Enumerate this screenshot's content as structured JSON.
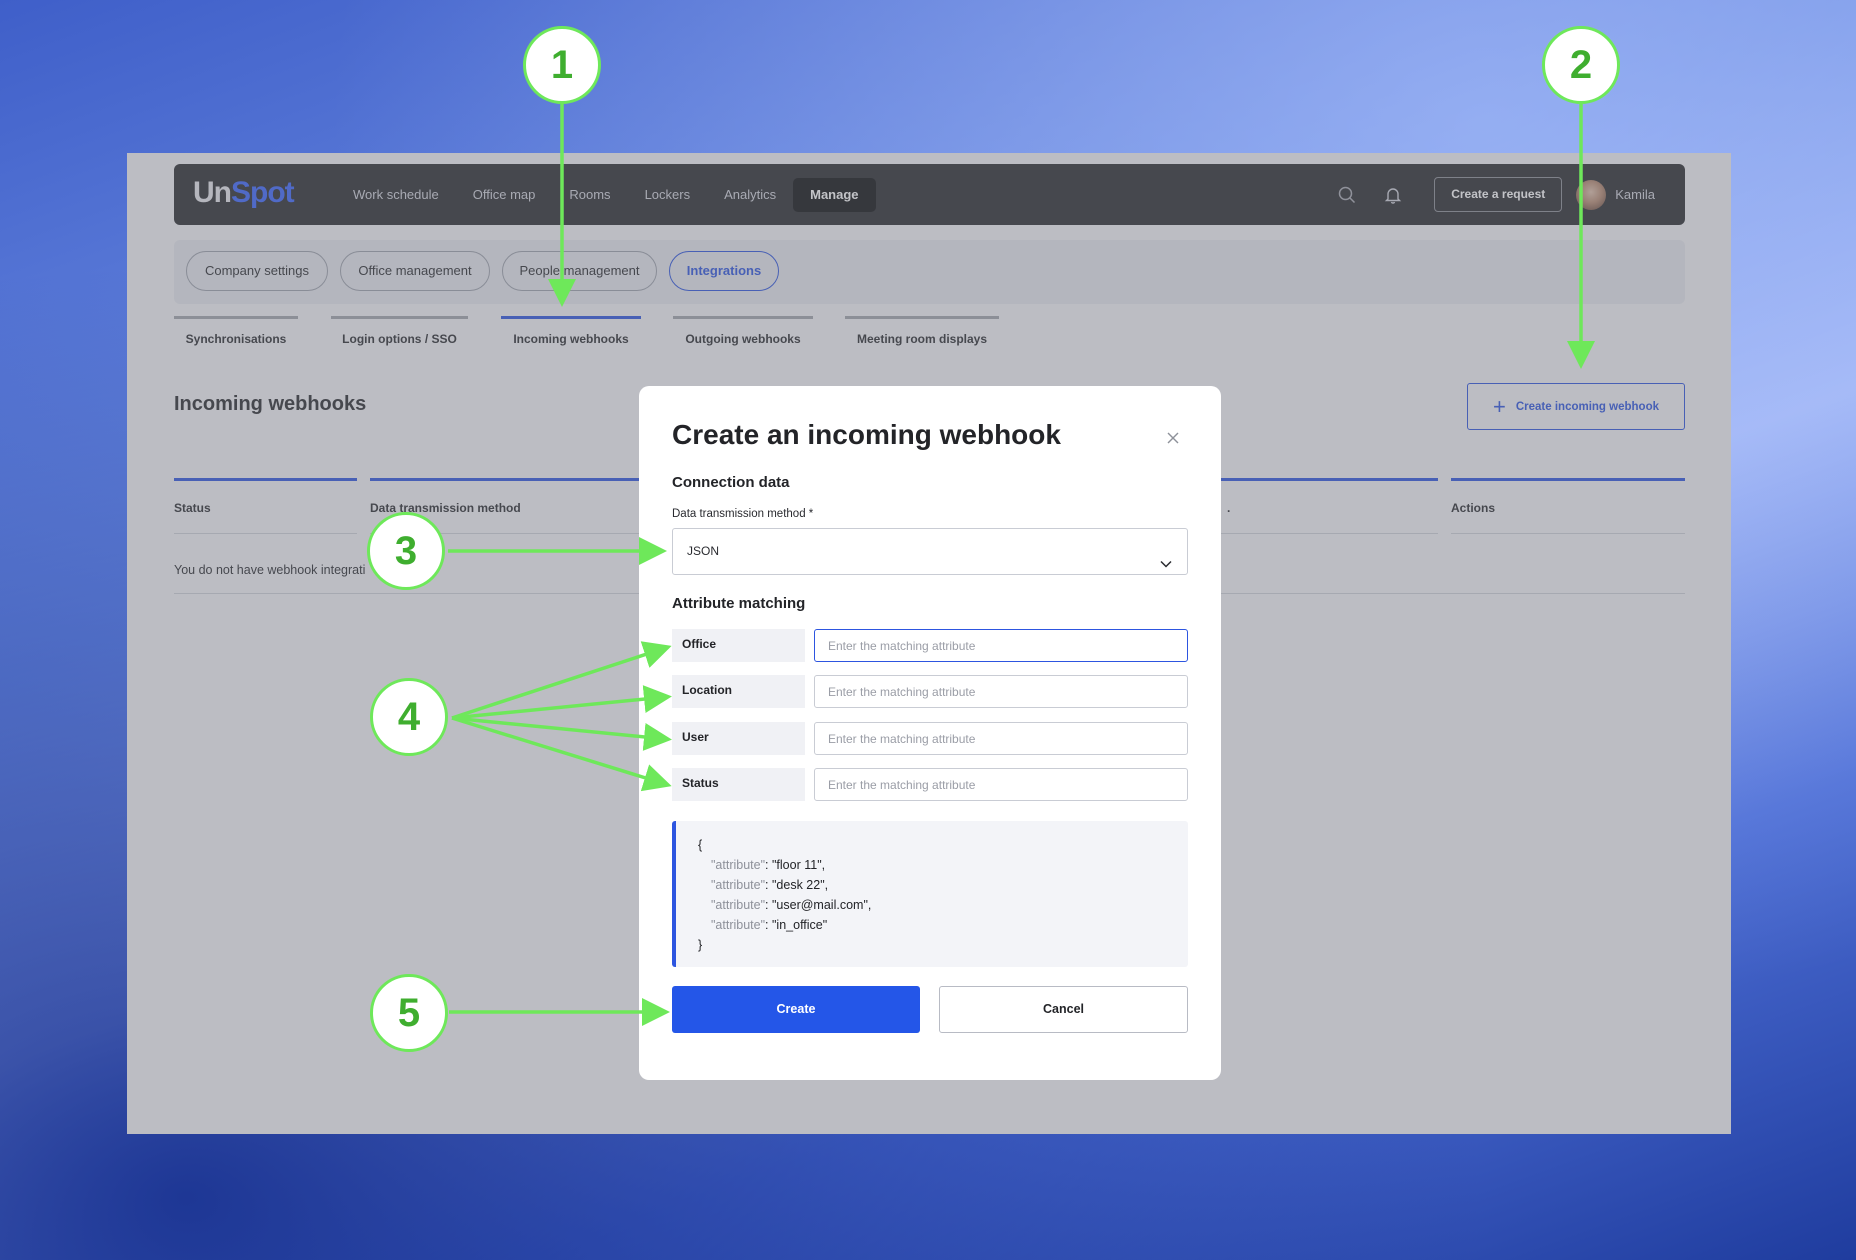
{
  "app": {
    "logo": {
      "part1": "Un",
      "part2": "Spot"
    },
    "nav": [
      "Work schedule",
      "Office map",
      "Rooms",
      "Lockers",
      "Analytics",
      "Manage"
    ],
    "active_nav": "Manage",
    "create_request_label": "Create a request",
    "user_name": "Kamila"
  },
  "subnav": {
    "pills": [
      "Company settings",
      "Office management",
      "People management",
      "Integrations"
    ],
    "active": "Integrations"
  },
  "tabs": {
    "items": [
      "Synchronisations",
      "Login options / SSO",
      "Incoming webhooks",
      "Outgoing webhooks",
      "Meeting room displays"
    ],
    "active": "Incoming webhooks"
  },
  "page": {
    "title": "Incoming webhooks",
    "create_button": "Create incoming webhook",
    "table_headers": [
      "Status",
      "Data transmission method",
      ".",
      "Actions"
    ],
    "empty_message": "You do not have webhook integrati"
  },
  "modal": {
    "title": "Create an incoming webhook",
    "connection_title": "Connection data",
    "method_label": "Data transmission method *",
    "method_value": "JSON",
    "matching_title": "Attribute matching",
    "attributes": [
      {
        "label": "Office",
        "placeholder": "Enter the matching attribute"
      },
      {
        "label": "Location",
        "placeholder": "Enter the matching attribute"
      },
      {
        "label": "User",
        "placeholder": "Enter the matching attribute"
      },
      {
        "label": "Status",
        "placeholder": "Enter the matching attribute"
      }
    ],
    "code": {
      "open": "{",
      "close": "}",
      "lines": [
        {
          "key": "\"attribute\"",
          "value": ": \"floor 11\","
        },
        {
          "key": "\"attribute\"",
          "value": ": \"desk 22\","
        },
        {
          "key": "\"attribute\"",
          "value": ": \"user@mail.com\","
        },
        {
          "key": "\"attribute\"",
          "value": ": \"in_office\""
        }
      ]
    },
    "create_label": "Create",
    "cancel_label": "Cancel"
  },
  "annotations": [
    "1",
    "2",
    "3",
    "4",
    "5"
  ],
  "colors": {
    "accent": "#2d55e0",
    "annotation": "#6ee85a",
    "topbar": "#2a2b30"
  }
}
